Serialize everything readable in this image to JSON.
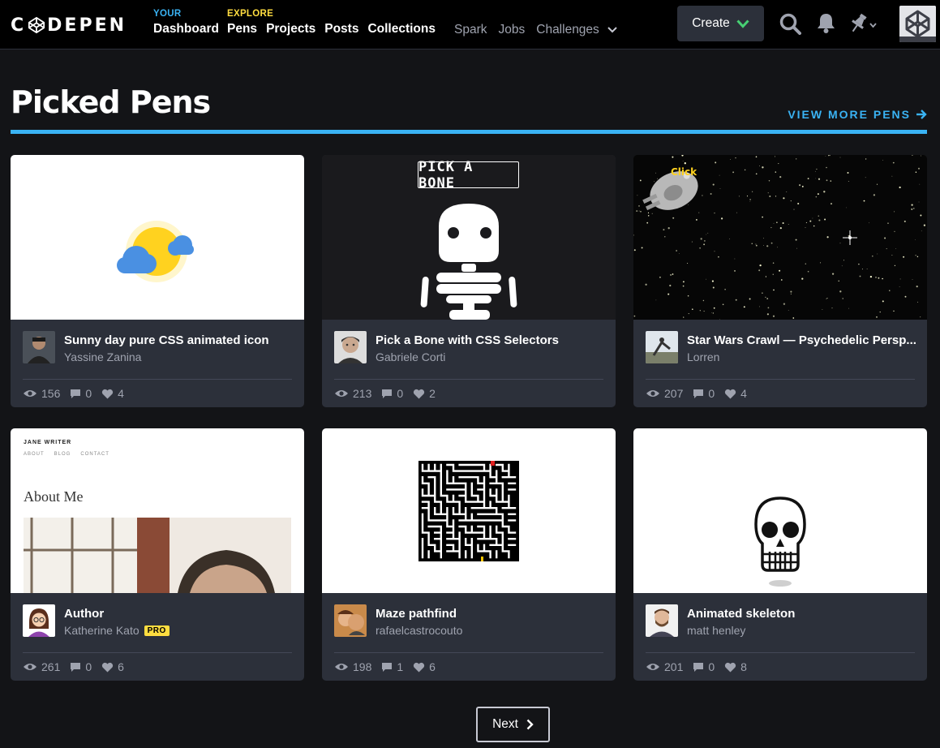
{
  "brand": {
    "logo_left": "C",
    "logo_right": "DEPEN"
  },
  "nav": {
    "your": {
      "caption": "YOUR",
      "links": [
        "Dashboard"
      ]
    },
    "explore": {
      "caption": "EXPLORE",
      "links": [
        "Pens",
        "Projects",
        "Posts",
        "Collections"
      ]
    },
    "secondary": [
      "Spark",
      "Jobs",
      "Challenges"
    ],
    "create_label": "Create"
  },
  "page": {
    "title": "Picked Pens",
    "view_more": "VIEW MORE PENS"
  },
  "pens": [
    {
      "title": "Sunny day pure CSS animated icon",
      "author": "Yassine Zanina",
      "pro": false,
      "views": "156",
      "comments": "0",
      "hearts": "4"
    },
    {
      "title": "Pick a Bone with CSS Selectors",
      "author": "Gabriele Corti",
      "pro": false,
      "views": "213",
      "comments": "0",
      "hearts": "2"
    },
    {
      "title": "Star Wars Crawl — Psychedelic Persp...",
      "author": "Lorren",
      "pro": false,
      "views": "207",
      "comments": "0",
      "hearts": "4"
    },
    {
      "title": "Author",
      "author": "Katherine Kato",
      "pro": true,
      "pro_label": "PRO",
      "views": "261",
      "comments": "0",
      "hearts": "6"
    },
    {
      "title": "Maze pathfind",
      "author": "rafaelcastrocouto",
      "pro": false,
      "views": "198",
      "comments": "1",
      "hearts": "6"
    },
    {
      "title": "Animated skeleton",
      "author": "matt henley",
      "pro": false,
      "views": "201",
      "comments": "0",
      "hearts": "8"
    }
  ],
  "previews": {
    "bone_sign": "PICK A BONE",
    "starwars_click": "Click",
    "author_site": {
      "name": "JANE WRITER",
      "nav": [
        "ABOUT",
        "BLOG",
        "CONTACT"
      ],
      "heading": "About Me"
    }
  },
  "pagination": {
    "next_label": "Next"
  },
  "colors": {
    "accent_blue": "#3ab3f4",
    "explore_yellow": "#ffdd40",
    "create_green": "#47cf73",
    "card_bg": "#2c303a",
    "page_bg": "#131417"
  }
}
